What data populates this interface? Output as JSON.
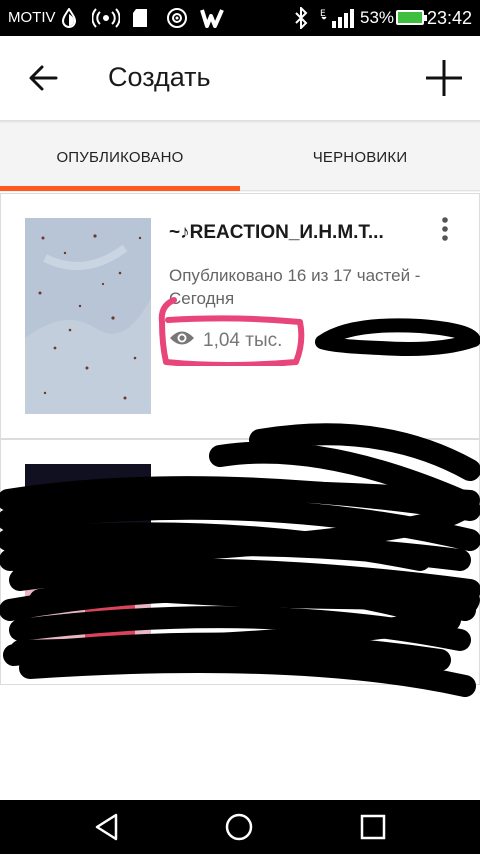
{
  "status_bar": {
    "carrier": "MOTIV",
    "battery_percent": "53%",
    "time": "23:42"
  },
  "app_bar": {
    "title": "Создать"
  },
  "tabs": [
    {
      "label": "ОПУБЛИКОВАНО",
      "selected": true
    },
    {
      "label": "ЧЕРНОВИКИ",
      "selected": false
    }
  ],
  "stories": [
    {
      "title": "~♪REACTION_И.Н.М.Т...",
      "subtitle": "Опубликовано 16 из 17 частей - Сегодня",
      "views": "1,04 тыс."
    }
  ],
  "colors": {
    "accent": "#ff5a1f",
    "highlight": "#e8457a"
  }
}
